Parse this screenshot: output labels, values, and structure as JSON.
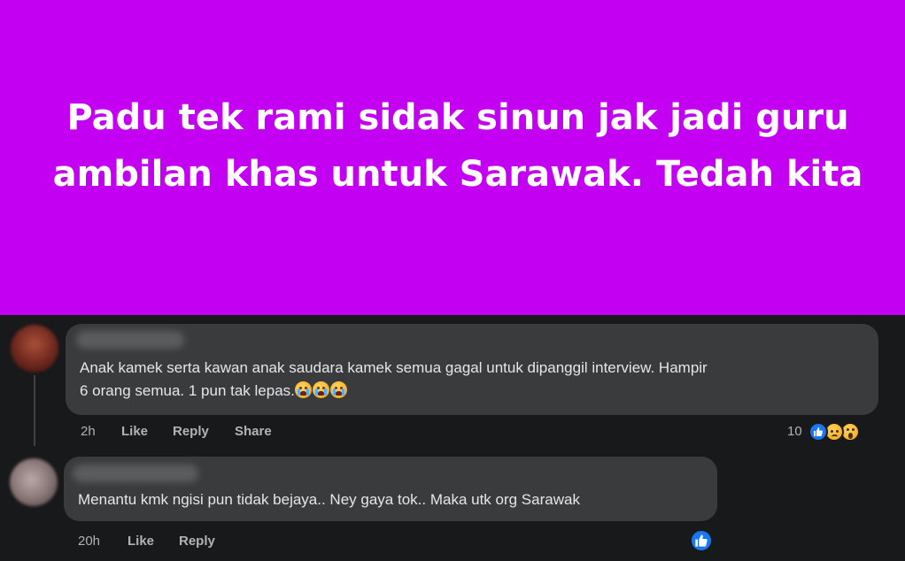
{
  "banner": {
    "line1": "Padu tek rami sidak sinun jak jadi guru",
    "line2": "ambilan khas untuk Sarawak. Tedah kita",
    "background": "#c400f2"
  },
  "comments": [
    {
      "text_line1": "Anak kamek serta kawan anak saudara kamek semua gagal untuk dipanggil interview. Hampir",
      "text_line2": "6 orang semua. 1 pun tak lepas.",
      "emojis": [
        "crying-face",
        "crying-face",
        "crying-face"
      ],
      "time": "2h",
      "like_label": "Like",
      "reply_label": "Reply",
      "share_label": "Share",
      "reaction_count": "10",
      "reactions": [
        "like",
        "sad",
        "wow"
      ]
    },
    {
      "text": "Menantu kmk ngisi pun tidak bejaya.. Ney gaya tok.. Maka utk org Sarawak",
      "time": "20h",
      "like_label": "Like",
      "reply_label": "Reply",
      "reactions": [
        "like"
      ]
    }
  ],
  "colors": {
    "feed_background": "#18191a",
    "bubble": "#3a3b3c",
    "text": "#e4e6eb",
    "secondary_text": "#b0b3b8",
    "like_blue": "#1877f2"
  }
}
